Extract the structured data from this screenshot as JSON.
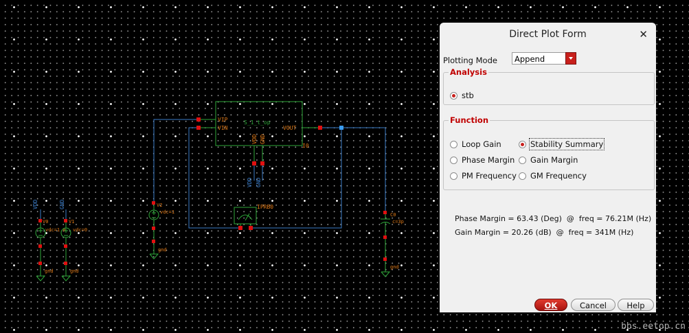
{
  "schematic": {
    "instance_name": "S_1_t_op",
    "pins": {
      "vip": "VIP",
      "vin": "VIN",
      "vout": "VOUT",
      "vdd": "VDD",
      "gnd": "GND",
      "i0": "I0"
    },
    "supply_labels": {
      "vdd": "VDD",
      "gnd": "GND"
    },
    "probe_name": "IPRB0",
    "source_v0": {
      "name": "V0",
      "value": "vdc=1.8"
    },
    "source_v1": {
      "name": "V1",
      "value": "vdc=0"
    },
    "source_v2": {
      "name": "V2",
      "value": "vdc=1"
    },
    "cap_c0": {
      "name": "C0",
      "value": "c=3p"
    },
    "gnd_labels": [
      "gnd",
      "gnd",
      "gnd",
      "gnd"
    ]
  },
  "dialog": {
    "title": "Direct Plot Form",
    "close_glyph": "✕",
    "plotting_mode_label": "Plotting Mode",
    "plotting_mode_value": "Append",
    "analysis": {
      "title": "Analysis",
      "options": [
        {
          "label": "stb",
          "selected": true
        }
      ]
    },
    "function": {
      "title": "Function",
      "options": [
        {
          "label": "Loop Gain",
          "selected": false
        },
        {
          "label": "Stability Summary",
          "selected": true
        },
        {
          "label": "Phase Margin",
          "selected": false
        },
        {
          "label": "Gain Margin",
          "selected": false
        },
        {
          "label": "PM Frequency",
          "selected": false
        },
        {
          "label": "GM Frequency",
          "selected": false
        }
      ]
    },
    "results": {
      "phase_margin": "Phase Margin = 63.43 (Deg)  @  freq = 76.21M (Hz)",
      "gain_margin": "Gain Margin = 20.26 (dB)  @  freq = 341M (Hz)"
    },
    "buttons": {
      "ok": "OK",
      "cancel": "Cancel",
      "help": "Help"
    }
  },
  "watermark": "bbs.eetop.cn",
  "colors": {
    "wire": "#3a7cc8",
    "symbol": "#2fa83a",
    "pin_red": "#e01010",
    "label_orange": "#e07a18",
    "ok_red": "#c8201c"
  }
}
